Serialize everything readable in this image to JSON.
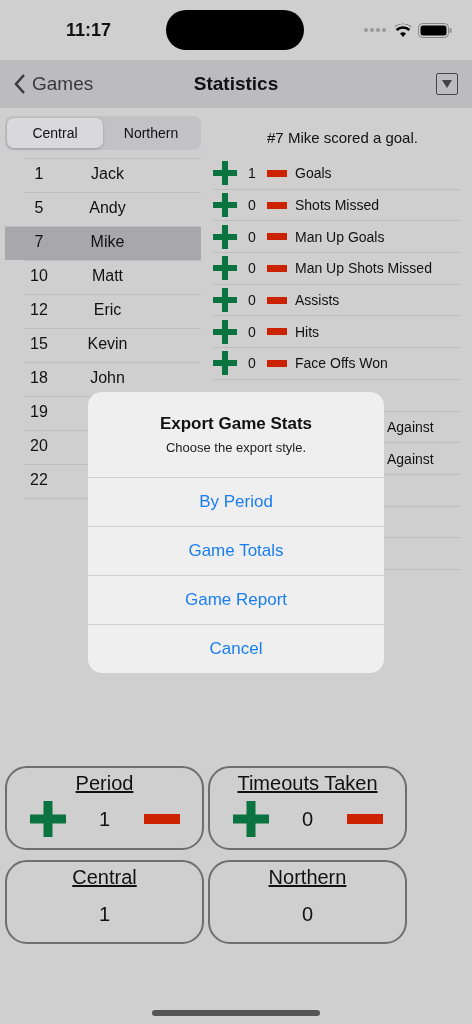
{
  "status_bar": {
    "time": "11:17"
  },
  "nav": {
    "back": "Games",
    "title": "Statistics"
  },
  "teams": [
    {
      "label": "Central",
      "selected": true
    },
    {
      "label": "Northern",
      "selected": false
    }
  ],
  "players": [
    {
      "number": "1",
      "name": "Jack",
      "selected": false
    },
    {
      "number": "5",
      "name": "Andy",
      "selected": false
    },
    {
      "number": "7",
      "name": "Mike",
      "selected": true
    },
    {
      "number": "10",
      "name": "Matt",
      "selected": false
    },
    {
      "number": "12",
      "name": "Eric",
      "selected": false
    },
    {
      "number": "15",
      "name": "Kevin",
      "selected": false
    },
    {
      "number": "18",
      "name": "John",
      "selected": false
    },
    {
      "number": "19",
      "selected": false
    },
    {
      "number": "20",
      "selected": false
    },
    {
      "number": "22",
      "selected": false
    }
  ],
  "message": "#7 Mike scored a goal.",
  "stats": [
    {
      "kind": "full",
      "value": "1",
      "label": "Goals"
    },
    {
      "kind": "full",
      "value": "0",
      "label": "Shots Missed"
    },
    {
      "kind": "full",
      "value": "0",
      "label": "Man Up Goals"
    },
    {
      "kind": "full",
      "value": "0",
      "label": "Man Up Shots Missed"
    },
    {
      "kind": "full",
      "value": "0",
      "label": "Assists"
    },
    {
      "kind": "full",
      "value": "0",
      "label": "Hits"
    },
    {
      "kind": "full",
      "value": "0",
      "label": "Face Offs Won"
    },
    {
      "kind": "hidden"
    },
    {
      "kind": "partial",
      "label": "Against"
    },
    {
      "kind": "partial",
      "label": "Against"
    },
    {
      "kind": "hidden"
    },
    {
      "kind": "hidden"
    },
    {
      "kind": "hidden"
    }
  ],
  "dialog": {
    "title": "Export Game Stats",
    "message": "Choose the export style.",
    "actions": [
      "By Period",
      "Game Totals",
      "Game Report",
      "Cancel"
    ]
  },
  "counters": [
    {
      "kind": "stepper",
      "title": "Period",
      "value": "1"
    },
    {
      "kind": "stepper",
      "title": "Timeouts Taken",
      "value": "0"
    },
    {
      "kind": "score",
      "title": "Central",
      "value": "1"
    },
    {
      "kind": "score",
      "title": "Northern",
      "value": "0"
    }
  ]
}
